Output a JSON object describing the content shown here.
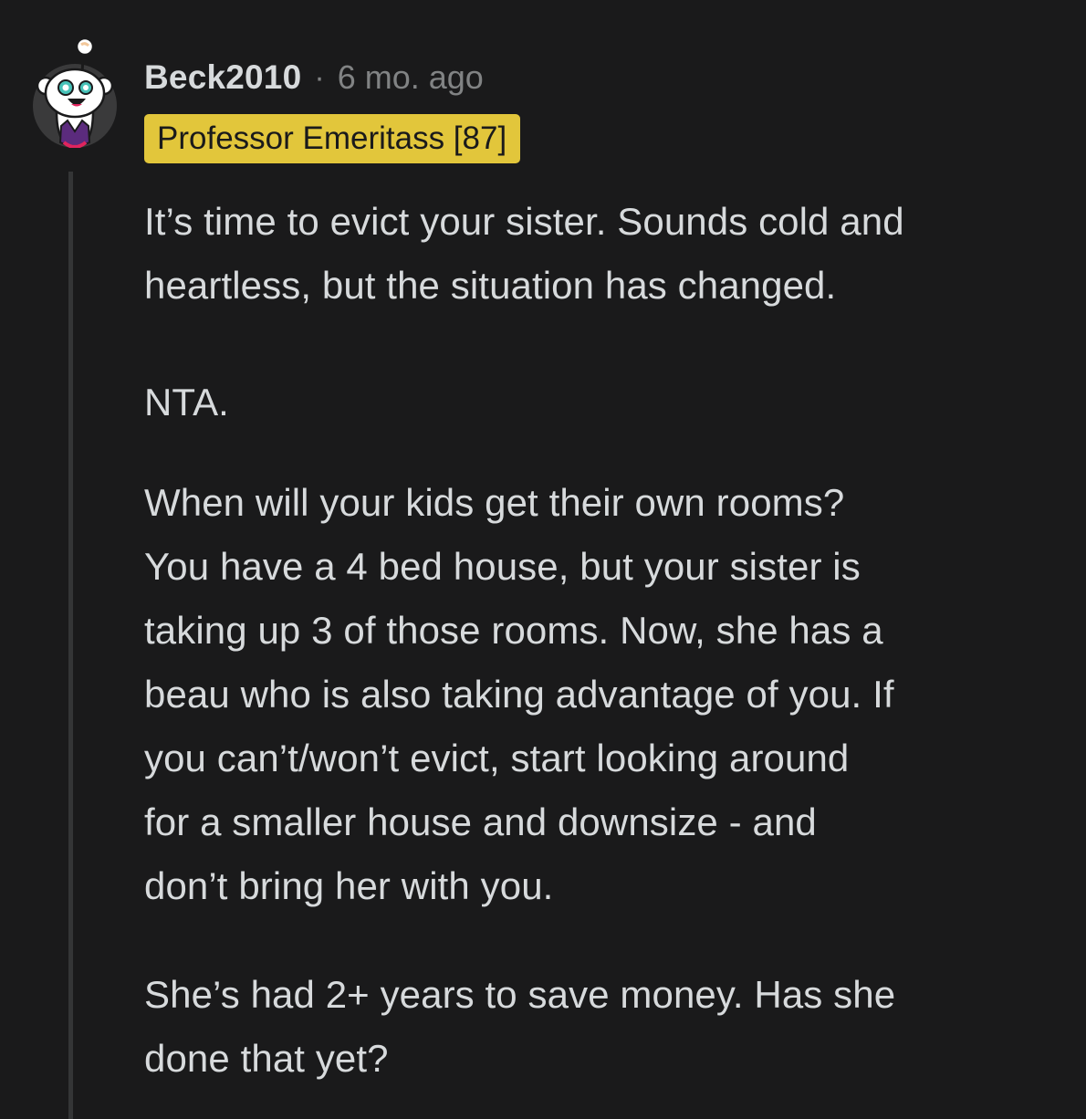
{
  "comment": {
    "username": "Beck2010",
    "separator": "·",
    "timestamp": "6 mo. ago",
    "flair": "Professor Emeritass [87]",
    "flair_color": "#e2c63b",
    "avatar_icon": "snoo-avatar-icon",
    "paragraphs": [
      [
        "It’s time to evict your sister. Sounds cold and",
        "heartless, but the situation has changed."
      ],
      [
        "NTA."
      ],
      [
        "When will your kids get their own rooms?",
        "You have a 4 bed house, but your sister is",
        "taking up 3 of those rooms. Now, she has a",
        "beau who is also taking advantage of you. If",
        "you can’t/won’t evict, start looking around",
        "for a smaller house and downsize - and",
        "don’t bring her with you."
      ],
      [
        "She’s had 2+ years to save money. Has she",
        "done that yet?"
      ]
    ]
  }
}
